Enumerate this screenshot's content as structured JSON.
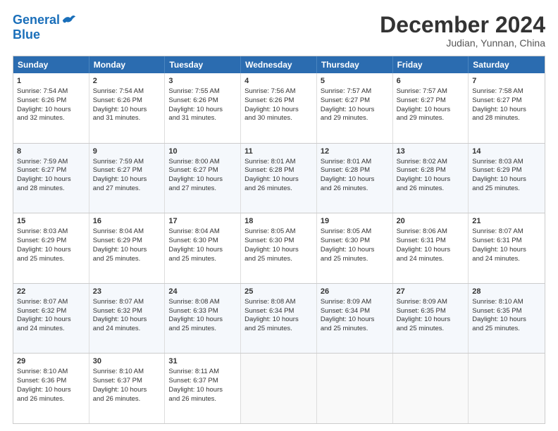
{
  "logo": {
    "line1": "General",
    "line2": "Blue"
  },
  "title": "December 2024",
  "location": "Judian, Yunnan, China",
  "header_days": [
    "Sunday",
    "Monday",
    "Tuesday",
    "Wednesday",
    "Thursday",
    "Friday",
    "Saturday"
  ],
  "weeks": [
    [
      {
        "day": "1",
        "lines": [
          "Sunrise: 7:54 AM",
          "Sunset: 6:26 PM",
          "Daylight: 10 hours",
          "and 32 minutes."
        ]
      },
      {
        "day": "2",
        "lines": [
          "Sunrise: 7:54 AM",
          "Sunset: 6:26 PM",
          "Daylight: 10 hours",
          "and 31 minutes."
        ]
      },
      {
        "day": "3",
        "lines": [
          "Sunrise: 7:55 AM",
          "Sunset: 6:26 PM",
          "Daylight: 10 hours",
          "and 31 minutes."
        ]
      },
      {
        "day": "4",
        "lines": [
          "Sunrise: 7:56 AM",
          "Sunset: 6:26 PM",
          "Daylight: 10 hours",
          "and 30 minutes."
        ]
      },
      {
        "day": "5",
        "lines": [
          "Sunrise: 7:57 AM",
          "Sunset: 6:27 PM",
          "Daylight: 10 hours",
          "and 29 minutes."
        ]
      },
      {
        "day": "6",
        "lines": [
          "Sunrise: 7:57 AM",
          "Sunset: 6:27 PM",
          "Daylight: 10 hours",
          "and 29 minutes."
        ]
      },
      {
        "day": "7",
        "lines": [
          "Sunrise: 7:58 AM",
          "Sunset: 6:27 PM",
          "Daylight: 10 hours",
          "and 28 minutes."
        ]
      }
    ],
    [
      {
        "day": "8",
        "lines": [
          "Sunrise: 7:59 AM",
          "Sunset: 6:27 PM",
          "Daylight: 10 hours",
          "and 28 minutes."
        ]
      },
      {
        "day": "9",
        "lines": [
          "Sunrise: 7:59 AM",
          "Sunset: 6:27 PM",
          "Daylight: 10 hours",
          "and 27 minutes."
        ]
      },
      {
        "day": "10",
        "lines": [
          "Sunrise: 8:00 AM",
          "Sunset: 6:27 PM",
          "Daylight: 10 hours",
          "and 27 minutes."
        ]
      },
      {
        "day": "11",
        "lines": [
          "Sunrise: 8:01 AM",
          "Sunset: 6:28 PM",
          "Daylight: 10 hours",
          "and 26 minutes."
        ]
      },
      {
        "day": "12",
        "lines": [
          "Sunrise: 8:01 AM",
          "Sunset: 6:28 PM",
          "Daylight: 10 hours",
          "and 26 minutes."
        ]
      },
      {
        "day": "13",
        "lines": [
          "Sunrise: 8:02 AM",
          "Sunset: 6:28 PM",
          "Daylight: 10 hours",
          "and 26 minutes."
        ]
      },
      {
        "day": "14",
        "lines": [
          "Sunrise: 8:03 AM",
          "Sunset: 6:29 PM",
          "Daylight: 10 hours",
          "and 25 minutes."
        ]
      }
    ],
    [
      {
        "day": "15",
        "lines": [
          "Sunrise: 8:03 AM",
          "Sunset: 6:29 PM",
          "Daylight: 10 hours",
          "and 25 minutes."
        ]
      },
      {
        "day": "16",
        "lines": [
          "Sunrise: 8:04 AM",
          "Sunset: 6:29 PM",
          "Daylight: 10 hours",
          "and 25 minutes."
        ]
      },
      {
        "day": "17",
        "lines": [
          "Sunrise: 8:04 AM",
          "Sunset: 6:30 PM",
          "Daylight: 10 hours",
          "and 25 minutes."
        ]
      },
      {
        "day": "18",
        "lines": [
          "Sunrise: 8:05 AM",
          "Sunset: 6:30 PM",
          "Daylight: 10 hours",
          "and 25 minutes."
        ]
      },
      {
        "day": "19",
        "lines": [
          "Sunrise: 8:05 AM",
          "Sunset: 6:30 PM",
          "Daylight: 10 hours",
          "and 25 minutes."
        ]
      },
      {
        "day": "20",
        "lines": [
          "Sunrise: 8:06 AM",
          "Sunset: 6:31 PM",
          "Daylight: 10 hours",
          "and 24 minutes."
        ]
      },
      {
        "day": "21",
        "lines": [
          "Sunrise: 8:07 AM",
          "Sunset: 6:31 PM",
          "Daylight: 10 hours",
          "and 24 minutes."
        ]
      }
    ],
    [
      {
        "day": "22",
        "lines": [
          "Sunrise: 8:07 AM",
          "Sunset: 6:32 PM",
          "Daylight: 10 hours",
          "and 24 minutes."
        ]
      },
      {
        "day": "23",
        "lines": [
          "Sunrise: 8:07 AM",
          "Sunset: 6:32 PM",
          "Daylight: 10 hours",
          "and 24 minutes."
        ]
      },
      {
        "day": "24",
        "lines": [
          "Sunrise: 8:08 AM",
          "Sunset: 6:33 PM",
          "Daylight: 10 hours",
          "and 25 minutes."
        ]
      },
      {
        "day": "25",
        "lines": [
          "Sunrise: 8:08 AM",
          "Sunset: 6:34 PM",
          "Daylight: 10 hours",
          "and 25 minutes."
        ]
      },
      {
        "day": "26",
        "lines": [
          "Sunrise: 8:09 AM",
          "Sunset: 6:34 PM",
          "Daylight: 10 hours",
          "and 25 minutes."
        ]
      },
      {
        "day": "27",
        "lines": [
          "Sunrise: 8:09 AM",
          "Sunset: 6:35 PM",
          "Daylight: 10 hours",
          "and 25 minutes."
        ]
      },
      {
        "day": "28",
        "lines": [
          "Sunrise: 8:10 AM",
          "Sunset: 6:35 PM",
          "Daylight: 10 hours",
          "and 25 minutes."
        ]
      }
    ],
    [
      {
        "day": "29",
        "lines": [
          "Sunrise: 8:10 AM",
          "Sunset: 6:36 PM",
          "Daylight: 10 hours",
          "and 26 minutes."
        ]
      },
      {
        "day": "30",
        "lines": [
          "Sunrise: 8:10 AM",
          "Sunset: 6:37 PM",
          "Daylight: 10 hours",
          "and 26 minutes."
        ]
      },
      {
        "day": "31",
        "lines": [
          "Sunrise: 8:11 AM",
          "Sunset: 6:37 PM",
          "Daylight: 10 hours",
          "and 26 minutes."
        ]
      },
      {
        "day": "",
        "lines": []
      },
      {
        "day": "",
        "lines": []
      },
      {
        "day": "",
        "lines": []
      },
      {
        "day": "",
        "lines": []
      }
    ]
  ]
}
